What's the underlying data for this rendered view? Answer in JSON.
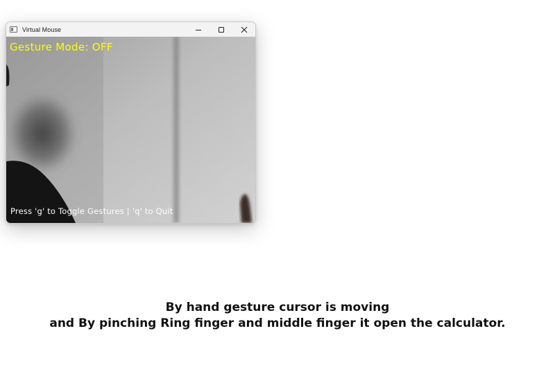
{
  "window": {
    "title": "Virtual Mouse",
    "controls": {
      "minimize_icon": "minimize-icon",
      "maximize_icon": "maximize-icon",
      "close_icon": "close-icon"
    }
  },
  "camera_view": {
    "gesture_mode_text": "Gesture Mode: OFF",
    "instructions_text": "Press 'g' to Toggle Gestures | 'q' to Quit",
    "gesture_mode_color": "#ffff00",
    "instructions_color": "#ffffff"
  },
  "caption": {
    "line1": "By hand gesture cursor is moving",
    "line2": "and By pinching Ring finger and middle finger it open the calculator."
  }
}
